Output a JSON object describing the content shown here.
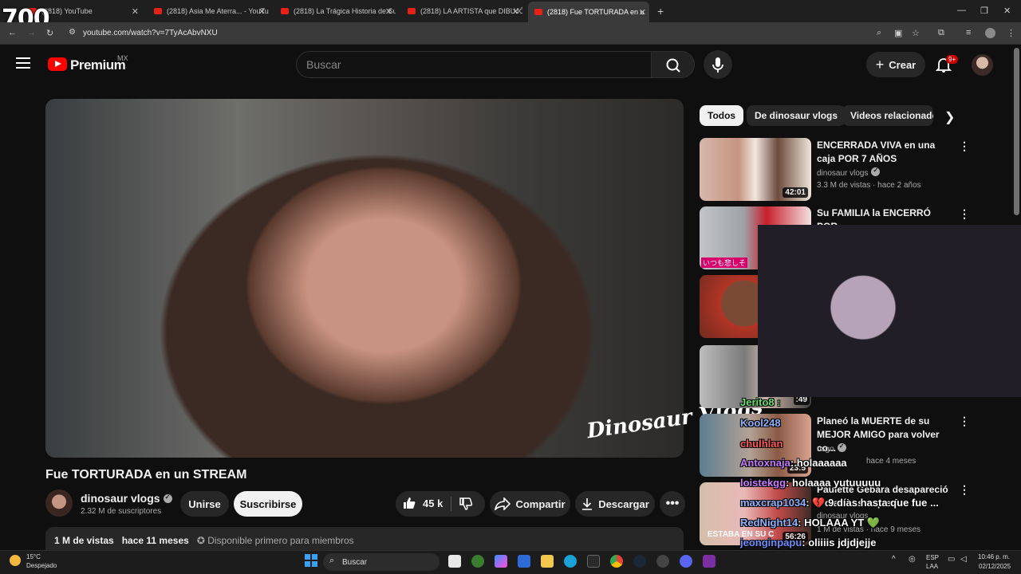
{
  "overlay": {
    "counter": "700"
  },
  "browser": {
    "tabs": [
      {
        "label": "(2818) YouTube"
      },
      {
        "label": "(2818) Asia Me Aterra... - YouTu"
      },
      {
        "label": "(2818) La Trágica Historia de Su"
      },
      {
        "label": "(2818) LA ARTISTA que DIBUJÓ"
      },
      {
        "label": "(2818) Fue TORTURADA en u"
      }
    ],
    "new_tab": "+",
    "url": "youtube.com/watch?v=7TyAcAbvNXU"
  },
  "header": {
    "brand": "Premium",
    "region": "MX",
    "search_placeholder": "Buscar",
    "create_label": "Crear",
    "notif_count": "9+"
  },
  "video": {
    "title": "Fue TORTURADA en un STREAM",
    "watermark": "Dinosaur Vlogs",
    "channel": "dinosaur vlogs",
    "subscribers": "2.32 M de suscriptores",
    "join_label": "Unirse",
    "subscribe_label": "Suscribirse",
    "likes": "45 k",
    "share_label": "Compartir",
    "download_label": "Descargar",
    "views": "1 M de vistas",
    "age": "hace 11 meses",
    "members_note": "Disponible primero para miembros"
  },
  "chips": [
    {
      "label": "Todos"
    },
    {
      "label": "De dinosaur vlogs"
    },
    {
      "label": "Videos relacionados"
    }
  ],
  "related": [
    {
      "title": "ENCERRADA VIVA en una caja POR 7 AÑOS",
      "channel": "dinosaur vlogs",
      "meta": "3.3 M de vistas · hace 2 años",
      "duration": "42:01"
    },
    {
      "title": "Su FAMILIA la ENCERRÓ POR",
      "channel": "",
      "meta": "",
      "duration": ""
    },
    {
      "title": "",
      "channel": "",
      "meta": "",
      "duration": ""
    },
    {
      "title": "",
      "channel": "",
      "meta": "",
      "duration": ":49"
    },
    {
      "title": "Planeó la MUERTE de su MEJOR AMIGO para volver co...",
      "channel": "usgo",
      "meta": "hace 4 meses",
      "duration": "23:5"
    },
    {
      "title": "Paulette Gebara desapareció 9 días hasta que fue ...",
      "channel": "dinosaur vlogs",
      "meta": "1 M de vistas · hace 9 meses",
      "duration": "56:26"
    }
  ],
  "thumb_texts": {
    "t2": "いつも悲しそ",
    "t6": "ESTABA EN SU C"
  },
  "chat": [
    {
      "user": "Jerito8",
      "msg": ":"
    },
    {
      "user": "Kool248",
      "msg": ""
    },
    {
      "user": "chulhlan",
      "msg": ""
    },
    {
      "user": "Antoxnaja",
      "msg": ": holaaaaaa"
    },
    {
      "user": "loistekgg",
      "msg": ": holaaaa yutuuuuu"
    },
    {
      "user": "maxcrap1034",
      "msg": ": 💔 9 días hasta que fue ..."
    },
    {
      "user": "RedNight14",
      "msg": ": HOLAAA YT 💚"
    },
    {
      "user": "jeonginpapu",
      "msg": ": oliiiis jdjdjejje"
    }
  ],
  "taskbar": {
    "temp": "15°C",
    "weather": "Despejado",
    "search": "Buscar",
    "lang1": "ESP",
    "lang2": "LAA",
    "time": "10:46 p. m.",
    "date": "02/12/2025"
  }
}
